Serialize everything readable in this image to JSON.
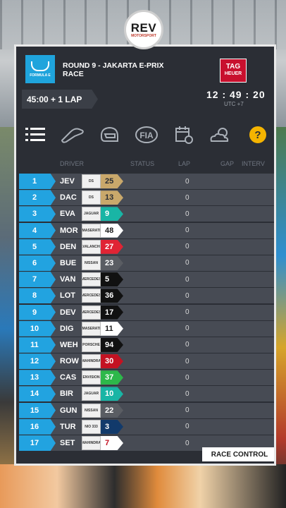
{
  "overlay_logo": "REV",
  "overlay_logo_sub": "MOTORSPORT",
  "header": {
    "series_logo": "FORMULA E",
    "round_line": "ROUND 9 - JAKARTA E-PRIX",
    "session": "RACE",
    "sponsor_line1": "TAG",
    "sponsor_line2": "HEUER",
    "duration": "45:00 + 1 LAP",
    "clock": "12 : 49 : 20",
    "timezone": "UTC +7"
  },
  "icons": [
    "list-icon",
    "track-icon",
    "helmet-icon",
    "fia-icon",
    "calendar-icon",
    "weather-icon",
    "help-icon"
  ],
  "fia_label": "FIA",
  "help_label": "?",
  "columns": {
    "driver": "DRIVER",
    "status": "STATUS",
    "lap": "LAP",
    "gap": "GAP",
    "interval": "INTERV"
  },
  "rows": [
    {
      "pos": "1",
      "code": "JEV",
      "team": "DS",
      "num": "25",
      "num_bg": "#c9a86b",
      "num_fg": "#2b2e35",
      "lap": "0"
    },
    {
      "pos": "2",
      "code": "DAC",
      "team": "DS",
      "num": "13",
      "num_bg": "#c9a86b",
      "num_fg": "#2b2e35",
      "lap": "0"
    },
    {
      "pos": "3",
      "code": "EVA",
      "team": "JAGUAR",
      "num": "9",
      "num_bg": "#19b5a5",
      "num_fg": "#ffffff",
      "lap": "0"
    },
    {
      "pos": "4",
      "code": "MOR",
      "team": "MASERATI",
      "num": "48",
      "num_bg": "#ffffff",
      "num_fg": "#1a1a1a",
      "lap": "0"
    },
    {
      "pos": "5",
      "code": "DEN",
      "team": "AVALANCHE",
      "num": "27",
      "num_bg": "#e02434",
      "num_fg": "#ffffff",
      "lap": "0"
    },
    {
      "pos": "6",
      "code": "BUE",
      "team": "NISSAN",
      "num": "23",
      "num_bg": "#5a5d63",
      "num_fg": "#ffffff",
      "lap": "0"
    },
    {
      "pos": "7",
      "code": "VAN",
      "team": "MERCEDES",
      "num": "5",
      "num_bg": "#111111",
      "num_fg": "#ffffff",
      "lap": "0"
    },
    {
      "pos": "8",
      "code": "LOT",
      "team": "MERCEDES",
      "num": "36",
      "num_bg": "#111111",
      "num_fg": "#ffffff",
      "lap": "0"
    },
    {
      "pos": "9",
      "code": "DEV",
      "team": "MERCEDES",
      "num": "17",
      "num_bg": "#111111",
      "num_fg": "#ffffff",
      "lap": "0"
    },
    {
      "pos": "10",
      "code": "DIG",
      "team": "MASERATI",
      "num": "11",
      "num_bg": "#ffffff",
      "num_fg": "#1a1a1a",
      "lap": "0"
    },
    {
      "pos": "11",
      "code": "WEH",
      "team": "PORSCHE",
      "num": "94",
      "num_bg": "#111111",
      "num_fg": "#ffffff",
      "lap": "0"
    },
    {
      "pos": "12",
      "code": "ROW",
      "team": "MAHINDRA",
      "num": "30",
      "num_bg": "#c41222",
      "num_fg": "#ffffff",
      "lap": "0"
    },
    {
      "pos": "13",
      "code": "CAS",
      "team": "ENVISION",
      "num": "37",
      "num_bg": "#2db84a",
      "num_fg": "#ffffff",
      "lap": "0"
    },
    {
      "pos": "14",
      "code": "BIR",
      "team": "JAGUAR",
      "num": "10",
      "num_bg": "#19b5a5",
      "num_fg": "#ffffff",
      "lap": "0"
    },
    {
      "pos": "15",
      "code": "GUN",
      "team": "NISSAN",
      "num": "22",
      "num_bg": "#5a5d63",
      "num_fg": "#ffffff",
      "lap": "0"
    },
    {
      "pos": "16",
      "code": "TUR",
      "team": "NIO 333",
      "num": "3",
      "num_bg": "#123a6b",
      "num_fg": "#ffffff",
      "lap": "0"
    },
    {
      "pos": "17",
      "code": "SET",
      "team": "MAHINDRA",
      "num": "7",
      "num_bg": "#ffffff",
      "num_fg": "#c41222",
      "lap": "0"
    }
  ],
  "footer": {
    "race_control": "RACE CONTROL"
  },
  "colors": {
    "position_blue": "#22a3e0",
    "row_bg": "#474b54",
    "panel_bg": "#2b2e35",
    "tag_red": "#c8102e",
    "help_yellow": "#f5b400"
  }
}
